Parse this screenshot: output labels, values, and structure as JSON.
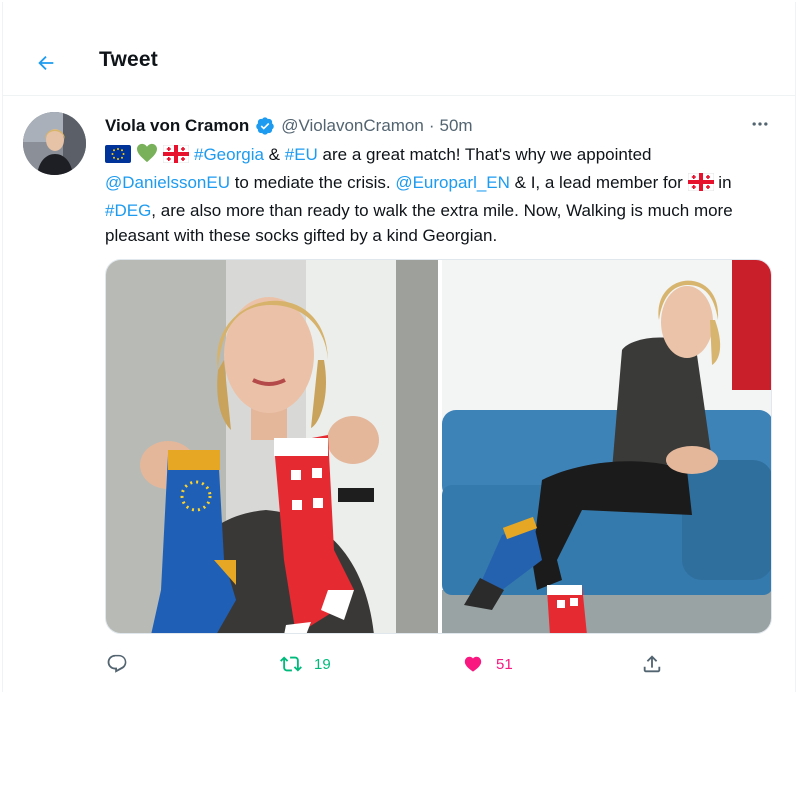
{
  "header": {
    "title": "Tweet"
  },
  "tweet": {
    "author_name": "Viola von Cramon",
    "handle": "@ViolavonCramon",
    "separator": "·",
    "time": "50m",
    "text_segments": [
      {
        "text": "#Georgia",
        "type": "link"
      },
      {
        "text": " & ",
        "type": "text"
      },
      {
        "text": "#EU",
        "type": "link"
      },
      {
        "text": " are a great match! That's why we appointed ",
        "type": "text"
      },
      {
        "text": "@DanielssonEU",
        "type": "link"
      },
      {
        "text": " to mediate the crisis. ",
        "type": "text"
      },
      {
        "text": "@Europarl_EN",
        "type": "link"
      },
      {
        "text": " & I, a lead member for ",
        "type": "text"
      },
      {
        "text": " in ",
        "type": "text"
      },
      {
        "text": "#DEG",
        "type": "link"
      },
      {
        "text": ", are also more than ready to walk the extra mile. Now, Walking is much more pleasant with these socks gifted by a kind Georgian.",
        "type": "text"
      }
    ],
    "emojis": [
      "eu-flag-emoji",
      "green-heart-emoji",
      "georgia-flag-emoji"
    ]
  },
  "actions": {
    "retweets": "19",
    "likes": "51"
  },
  "colors": {
    "accent": "#1d9bf0",
    "retweet": "#00ba7c",
    "like": "#f91880",
    "muted": "#536471"
  }
}
